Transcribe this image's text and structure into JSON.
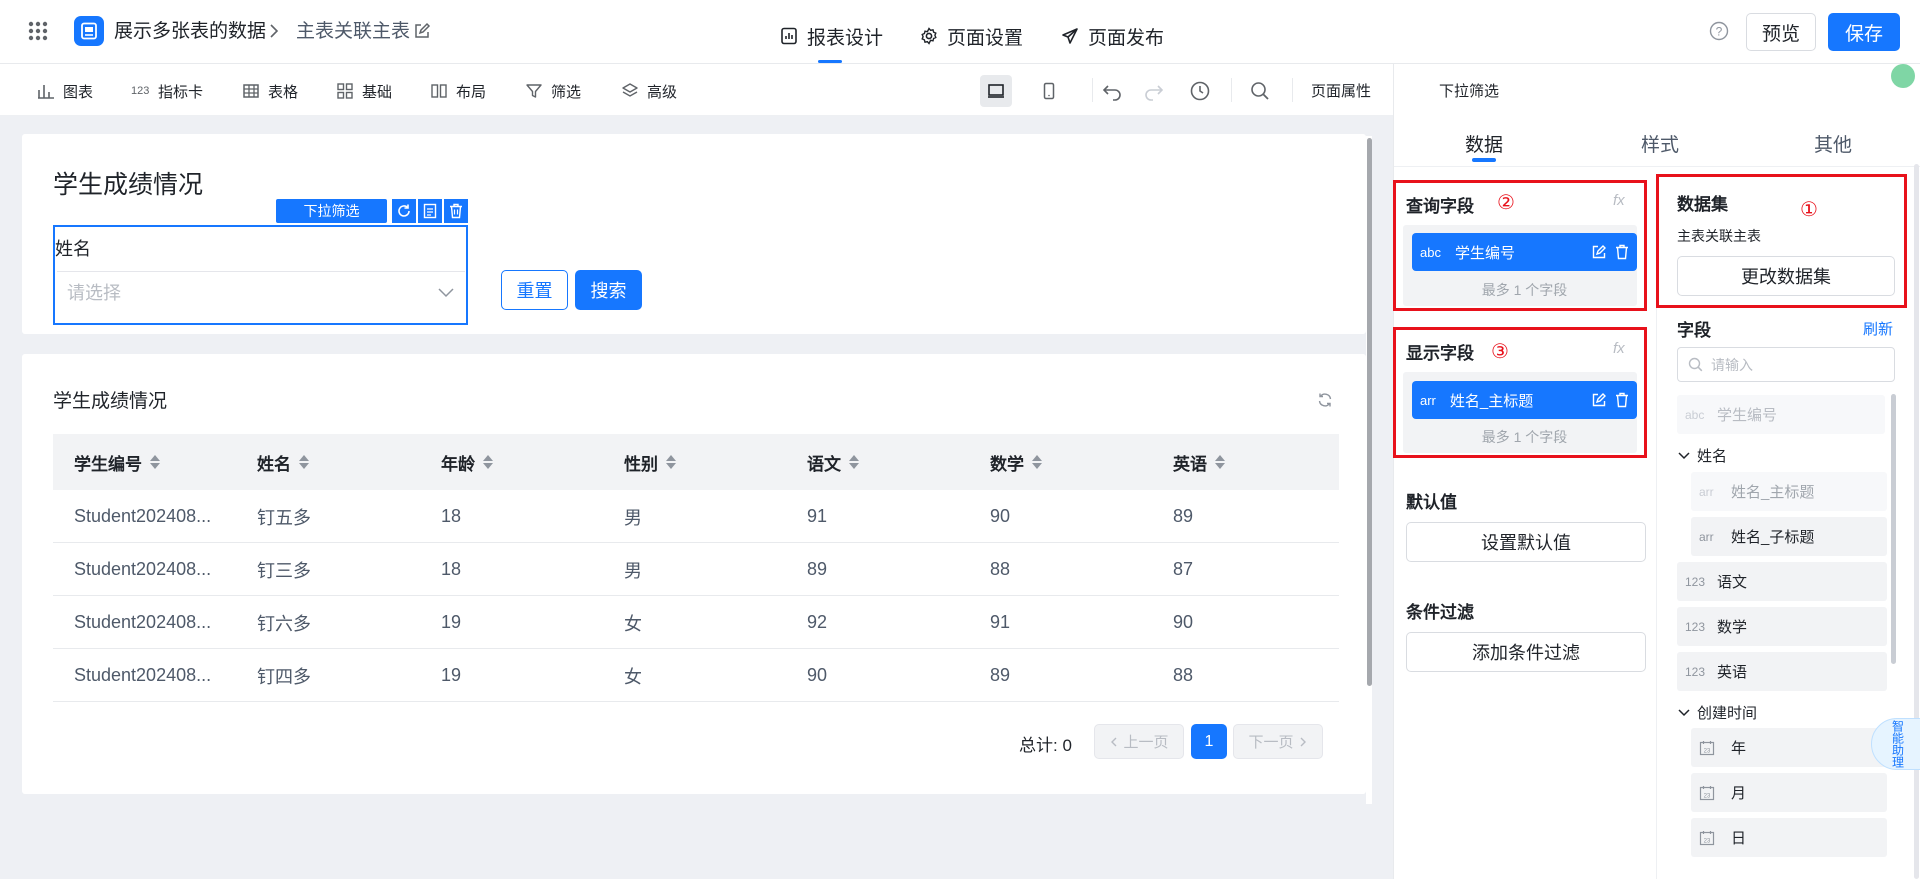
{
  "colors": {
    "primary": "#1677ff",
    "highlight": "#e8111b",
    "canvas": "#eef0f4"
  },
  "header": {
    "app_title": "展示多张表的数据",
    "page_name": "主表关联主表",
    "nav": [
      {
        "label": "报表设计",
        "icon": "report-icon"
      },
      {
        "label": "页面设置",
        "icon": "gear-icon"
      },
      {
        "label": "页面发布",
        "icon": "send-icon"
      }
    ],
    "preview_label": "预览",
    "save_label": "保存"
  },
  "toolbar": {
    "tools": [
      {
        "label": "图表",
        "icon": "chart-icon"
      },
      {
        "label": "指标卡",
        "icon": "metric-icon"
      },
      {
        "label": "表格",
        "icon": "table-icon"
      },
      {
        "label": "基础",
        "icon": "basic-icon"
      },
      {
        "label": "布局",
        "icon": "layout-icon"
      },
      {
        "label": "筛选",
        "icon": "filter-icon"
      },
      {
        "label": "高级",
        "icon": "layers-icon"
      }
    ],
    "page_props_label": "页面属性",
    "selected_component": "下拉筛选"
  },
  "filter_card": {
    "title": "学生成绩情况",
    "tag_label": "下拉筛选",
    "field_label": "姓名",
    "select_placeholder": "请选择",
    "reset_label": "重置",
    "search_label": "搜索"
  },
  "table_card": {
    "title": "学生成绩情况",
    "columns": [
      "学生编号",
      "姓名",
      "年龄",
      "性别",
      "语文",
      "数学",
      "英语"
    ],
    "rows": [
      [
        "Student202408...",
        "钉五多",
        "18",
        "男",
        "91",
        "90",
        "89"
      ],
      [
        "Student202408...",
        "钉三多",
        "18",
        "男",
        "89",
        "88",
        "87"
      ],
      [
        "Student202408...",
        "钉六多",
        "19",
        "女",
        "92",
        "91",
        "90"
      ],
      [
        "Student202408...",
        "钉四多",
        "19",
        "女",
        "90",
        "89",
        "88"
      ]
    ],
    "total_label": "总计: 0",
    "prev_label": "上一页",
    "page": "1",
    "next_label": "下一页"
  },
  "panel": {
    "tabs": [
      "数据",
      "样式",
      "其他"
    ],
    "query": {
      "title": "查询字段",
      "marker": "②",
      "fx": "fx",
      "pill_type": "abc",
      "pill_label": "学生编号",
      "hint": "最多 1 个字段"
    },
    "display": {
      "title": "显示字段",
      "marker": "③",
      "fx": "fx",
      "pill_type": "arr",
      "pill_label": "姓名_主标题",
      "hint": "最多 1 个字段"
    },
    "default_title": "默认值",
    "default_btn": "设置默认值",
    "filter_title": "条件过滤",
    "filter_btn": "添加条件过滤",
    "dataset": {
      "title": "数据集",
      "marker": "①",
      "name": "主表关联主表",
      "change_btn": "更改数据集"
    },
    "fields": {
      "title": "字段",
      "refresh": "刷新",
      "search_placeholder": "请输入",
      "items": [
        {
          "type": "abc",
          "label": "学生编号"
        },
        {
          "group": "姓名"
        },
        {
          "type": "arr",
          "label": "姓名_主标题"
        },
        {
          "type": "arr",
          "label": "姓名_子标题"
        },
        {
          "type": "123",
          "label": "语文"
        },
        {
          "type": "123",
          "label": "数学"
        },
        {
          "type": "123",
          "label": "英语"
        },
        {
          "group": "创建时间"
        },
        {
          "type": "date",
          "label": "年"
        },
        {
          "type": "date",
          "label": "月"
        },
        {
          "type": "date",
          "label": "日"
        }
      ]
    },
    "float_btn": "智能助理"
  }
}
